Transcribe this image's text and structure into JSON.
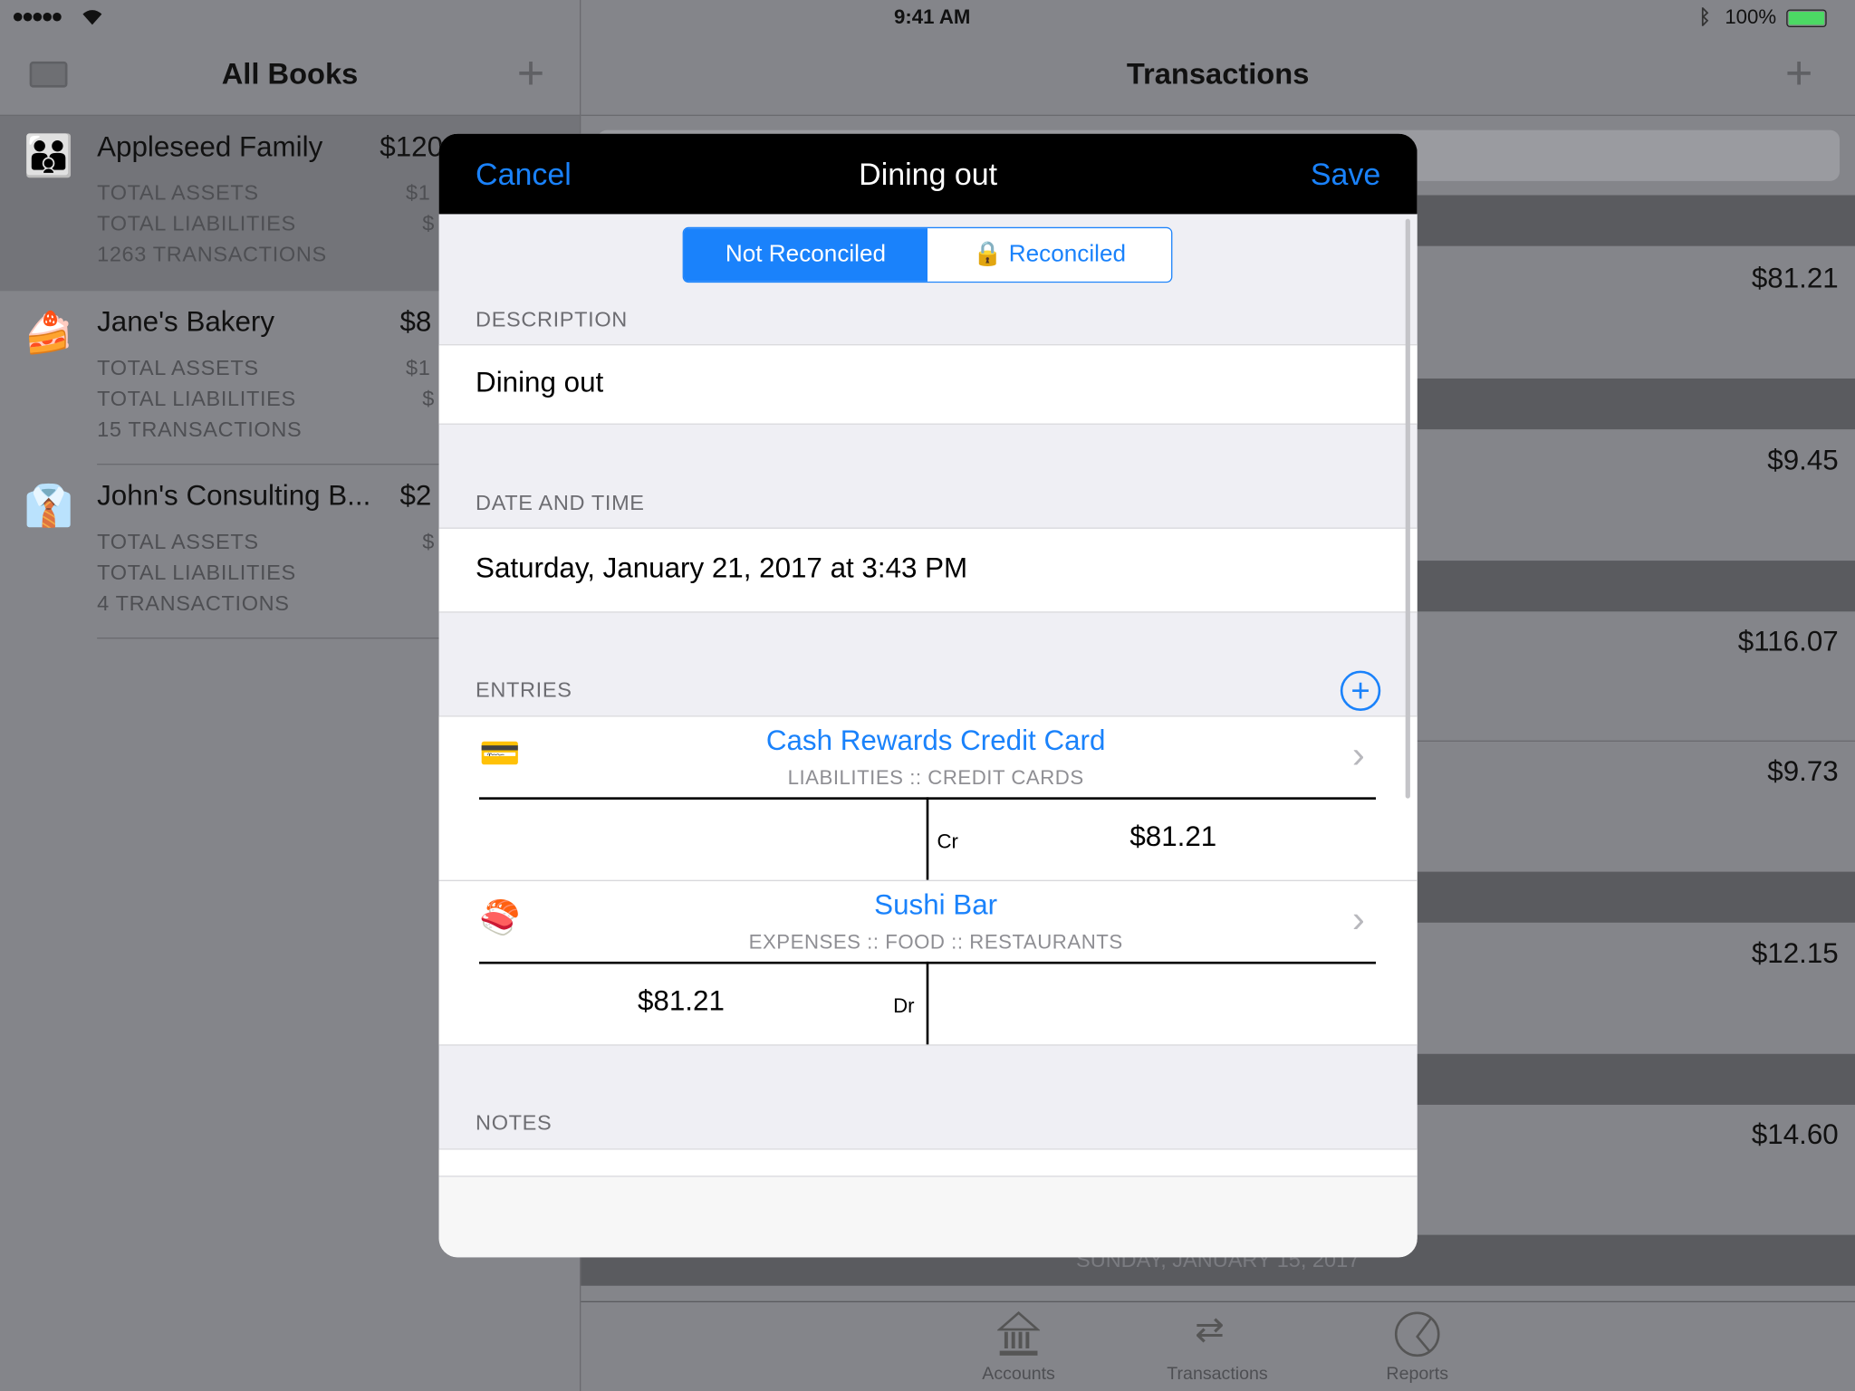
{
  "status_bar": {
    "time": "9:41 AM",
    "battery": "100%",
    "signal": "●●●●●"
  },
  "left_pane": {
    "title": "All Books",
    "books": [
      {
        "name": "Appleseed Family",
        "amount": "$120",
        "assets_label": "TOTAL ASSETS",
        "assets_value": "$1",
        "liabilities_label": "TOTAL LIABILITIES",
        "liabilities_value": "$",
        "transactions": "1263 TRANSACTIONS",
        "icon": "family-emoji"
      },
      {
        "name": "Jane's Bakery",
        "amount": "$8",
        "assets_label": "TOTAL ASSETS",
        "assets_value": "$1",
        "liabilities_label": "TOTAL LIABILITIES",
        "liabilities_value": "$",
        "transactions": "15 TRANSACTIONS",
        "icon": "cake-emoji"
      },
      {
        "name": "John's Consulting B...",
        "amount": "$2",
        "assets_label": "TOTAL ASSETS",
        "assets_value": "$",
        "liabilities_label": "TOTAL LIABILITIES",
        "liabilities_value": "",
        "transactions": "4 TRANSACTIONS",
        "icon": "shirt-tie-emoji"
      }
    ]
  },
  "right_pane": {
    "title": "Transactions",
    "amounts": [
      "$81.21",
      "$9.45",
      "$116.07",
      "$9.73",
      "$12.15",
      "$14.60"
    ],
    "section_date": "SUNDAY, JANUARY 15, 2017"
  },
  "tab_bar": {
    "items": [
      {
        "label": "Accounts",
        "icon": "bank-icon"
      },
      {
        "label": "Transactions",
        "icon": "transfer-arrows-icon"
      },
      {
        "label": "Reports",
        "icon": "pie-chart-icon"
      }
    ]
  },
  "modal": {
    "cancel": "Cancel",
    "title": "Dining out",
    "save": "Save",
    "segments": [
      "Not Reconciled",
      "Reconciled"
    ],
    "selected_segment": "Not Reconciled",
    "description_header": "DESCRIPTION",
    "description": "Dining out",
    "date_header": "DATE AND TIME",
    "date": "Saturday, January 21, 2017 at 3:43 PM",
    "entries_header": "ENTRIES",
    "entries": [
      {
        "name": "Cash Rewards Credit Card",
        "path": "LIABILITIES :: CREDIT CARDS",
        "side": "Cr",
        "amount": "$81.21",
        "icon": "credit-card-emoji"
      },
      {
        "name": "Sushi Bar",
        "path": "EXPENSES :: FOOD :: RESTAURANTS",
        "side": "Dr",
        "amount": "$81.21",
        "icon": "sushi-emoji"
      }
    ],
    "notes_header": "NOTES"
  },
  "colors": {
    "accent": "#1a82fb",
    "dim_background": "#84858a",
    "section": "#5a5b5f"
  }
}
